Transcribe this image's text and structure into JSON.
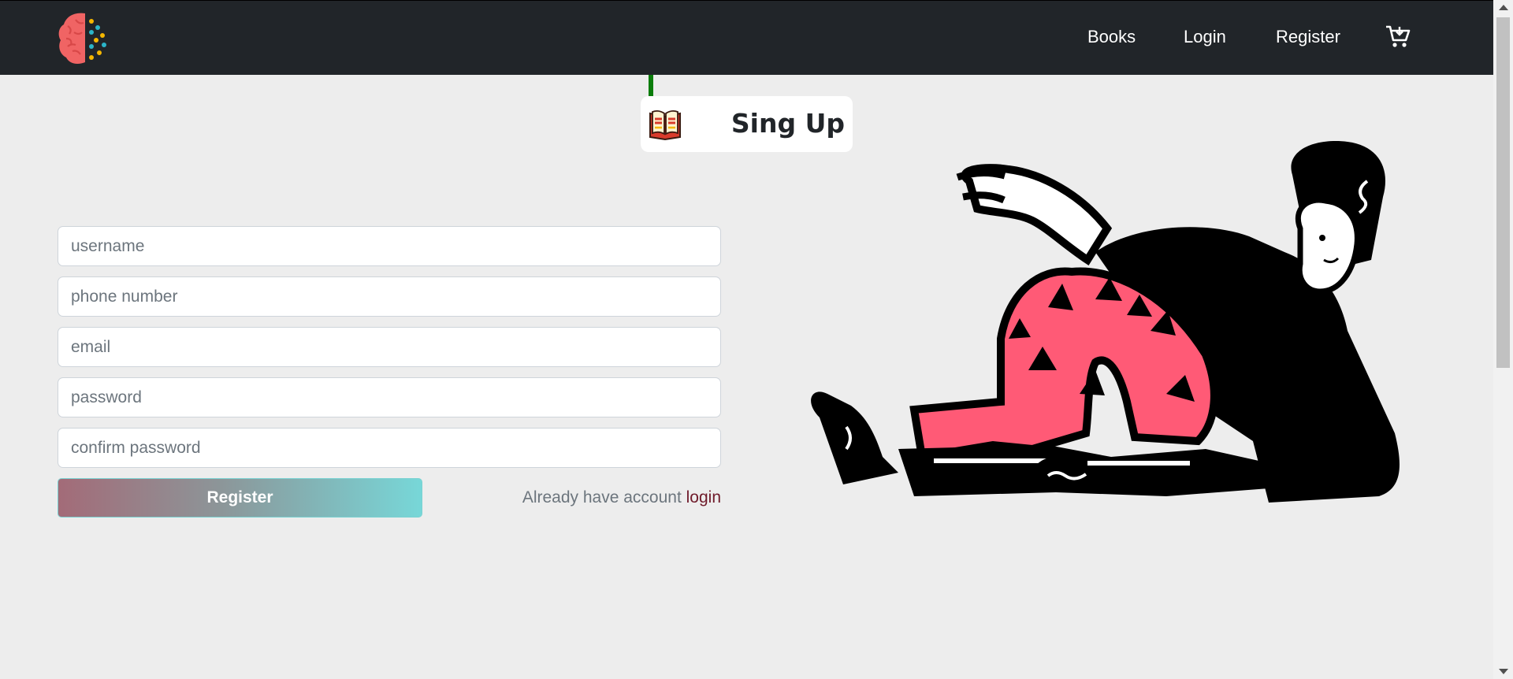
{
  "navbar": {
    "links": [
      {
        "label": "Books"
      },
      {
        "label": "Login"
      },
      {
        "label": "Register"
      }
    ]
  },
  "page": {
    "title": "Sing Up"
  },
  "form": {
    "username_placeholder": "username",
    "phone_placeholder": "phone number",
    "email_placeholder": "email",
    "password_placeholder": "password",
    "confirm_password_placeholder": "confirm password",
    "submit_label": "Register",
    "already_text": "Already have account",
    "login_link_label": "login"
  },
  "colors": {
    "navbar_bg": "#212529",
    "page_bg": "#ededed",
    "accent_pink": "#ff5a76",
    "button_gradient_start": "#a36b78",
    "button_gradient_end": "#77d7d8",
    "login_link": "#6f1a2a"
  },
  "icons": [
    "brain-logo-icon",
    "cart-icon",
    "book-icon"
  ]
}
